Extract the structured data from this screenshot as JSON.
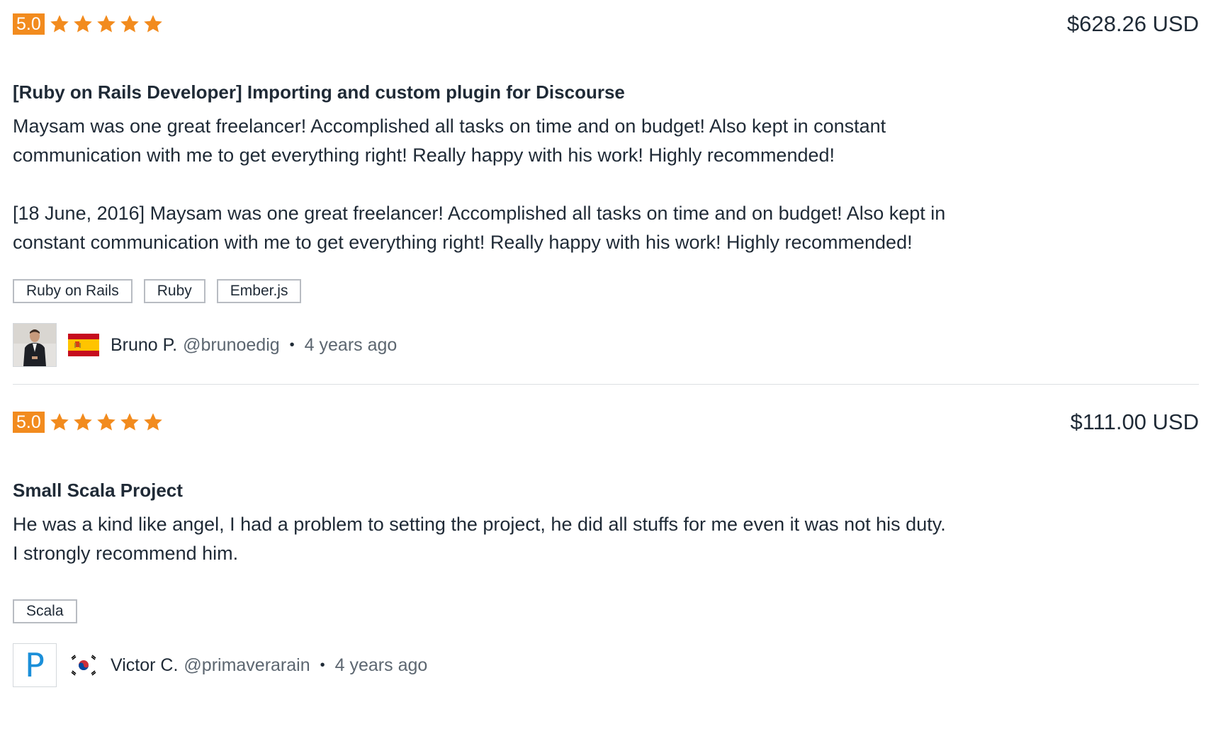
{
  "colors": {
    "accent": "#f28b1e",
    "text": "#1f2a36",
    "muted": "#5c6670",
    "avatar_letter": "#1b8fd9"
  },
  "reviews": [
    {
      "rating": "5.0",
      "stars": 5,
      "price": "$628.26 USD",
      "title": "[Ruby on Rails Developer] Importing and custom plugin for Discourse",
      "body": "Maysam was one great freelancer! Accomplished all tasks on time and on budget! Also kept in constant communication with me to get everything right! Really happy with his work! Highly recommended!\n\n[18 June, 2016] Maysam was one great freelancer! Accomplished all tasks on time and on budget! Also kept in constant communication with me to get everything right! Really happy with his work! Highly recommended!",
      "tags": [
        "Ruby on Rails",
        "Ruby",
        "Ember.js"
      ],
      "reviewer": {
        "name": "Bruno P.",
        "handle": "@brunoedig",
        "time": "4 years ago",
        "flag": "spain-flag-icon",
        "avatar": "user-photo"
      }
    },
    {
      "rating": "5.0",
      "stars": 5,
      "price": "$111.00 USD",
      "title": "Small Scala Project",
      "body": "He was a kind like angel, I had a problem to setting the project, he did all stuffs for me even it was not his duty.\nI strongly recommend him.",
      "tags": [
        "Scala"
      ],
      "reviewer": {
        "name": "Victor C.",
        "handle": "@primaverarain",
        "time": "4 years ago",
        "flag": "south-korea-flag-icon",
        "avatar_letter": "P"
      }
    }
  ],
  "separator": "•"
}
